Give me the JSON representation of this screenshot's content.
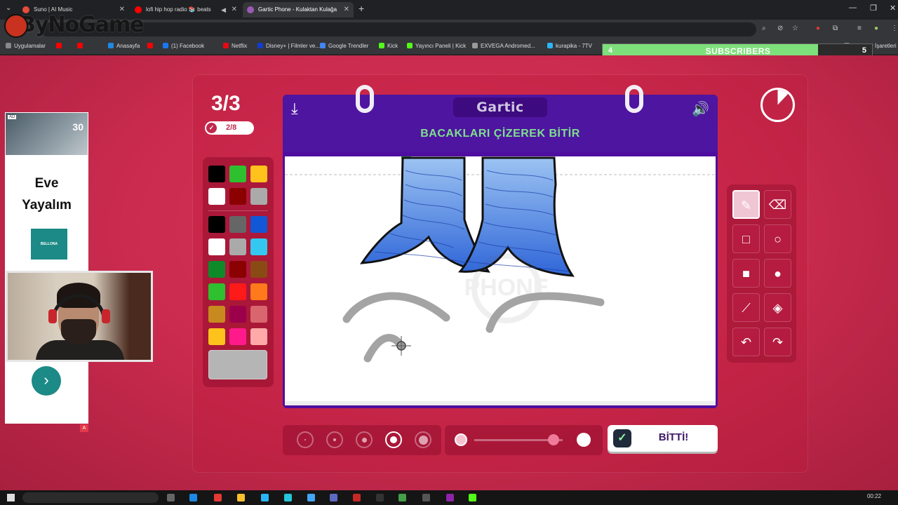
{
  "tabs": [
    {
      "title": "Suno | AI Music",
      "color": "#e74c3c"
    },
    {
      "title": "lofi hip hop radio 📚 beats",
      "color": "#ff0000"
    },
    {
      "title": "Gartic Phone - Kulaktan Kulağa",
      "color": "#9b59b6"
    }
  ],
  "watermark": "ByNoGame",
  "bookmarks": [
    {
      "label": "Uygulamalar",
      "color": "#888"
    },
    {
      "label": "",
      "color": "#ff0000"
    },
    {
      "label": "",
      "color": "#ff0000"
    },
    {
      "label": "Anasayfa",
      "color": "#1e88e5"
    },
    {
      "label": "",
      "color": "#ff0000"
    },
    {
      "label": "(1) Facebook",
      "color": "#1877f2"
    },
    {
      "label": "Netflix",
      "color": "#e50914"
    },
    {
      "label": "Disney+ | Filmler ve...",
      "color": "#113ccf"
    },
    {
      "label": "Google Trendler",
      "color": "#4285f4"
    },
    {
      "label": "Kick",
      "color": "#53fc18"
    },
    {
      "label": "Yayıncı Paneli | Kick",
      "color": "#53fc18"
    },
    {
      "label": "EXVEGA Andromed...",
      "color": "#999"
    },
    {
      "label": "kurapika - 7TV",
      "color": "#29b6f6"
    },
    {
      "label": "Tüm Yer İşaretleri",
      "color": "#888"
    }
  ],
  "subscribers": {
    "label": "SUBSCRIBERS",
    "current": "4",
    "goal": "5",
    "progress": 0.8
  },
  "ad": {
    "badge": "AD",
    "promo": "30",
    "headline_line1": "Eve",
    "headline_line2": "Yayalım",
    "brand": "BELLONA",
    "next_icon": "chevron-right-icon",
    "flag": "A"
  },
  "game": {
    "round": "3/3",
    "votes": "2/8",
    "logo": "Gartic",
    "prompt": "BACAKLARI ÇİZEREK BİTİR",
    "done_label": "BİTTİ!",
    "timer_progress": 0.12,
    "selected_tool": "pencil",
    "selected_size": 4,
    "opacity_level": 0.9
  },
  "palette": {
    "top": [
      "#000000",
      "#2ec02e",
      "#ffc21c",
      "#ffffff",
      "#8b0000",
      "#aaaaaa"
    ],
    "grid": [
      "#000000",
      "#666666",
      "#1258d6",
      "#ffffff",
      "#aaaaaa",
      "#34c8f0",
      "#0e8a2a",
      "#8b0000",
      "#8a4a14",
      "#2ec02e",
      "#ff1a1a",
      "#ff7a1a",
      "#c88a1e",
      "#9c004a",
      "#d9666e",
      "#ffc21c",
      "#ff1a8c",
      "#ffaaa8"
    ],
    "current": "#b5b5b5"
  },
  "tools": [
    {
      "name": "pencil-tool",
      "icon": "pencil-icon",
      "glyph": "✎"
    },
    {
      "name": "eraser-tool",
      "icon": "eraser-icon",
      "glyph": "⌫"
    },
    {
      "name": "rect-outline-tool",
      "icon": "square-outline-icon",
      "glyph": "□"
    },
    {
      "name": "ellipse-outline-tool",
      "icon": "circle-outline-icon",
      "glyph": "○"
    },
    {
      "name": "rect-fill-tool",
      "icon": "square-filled-icon",
      "glyph": "■"
    },
    {
      "name": "ellipse-fill-tool",
      "icon": "circle-filled-icon",
      "glyph": "●"
    },
    {
      "name": "line-tool",
      "icon": "line-icon",
      "glyph": "⟋"
    },
    {
      "name": "fill-tool",
      "icon": "bucket-icon",
      "glyph": "◈"
    },
    {
      "name": "undo-tool",
      "icon": "undo-icon",
      "glyph": "↶"
    },
    {
      "name": "redo-tool",
      "icon": "redo-icon",
      "glyph": "↷"
    }
  ],
  "taskbar": {
    "time": "00:22"
  },
  "colors": {
    "accent": "#4e15a0",
    "prompt": "#7de08c",
    "page": "#d32f55"
  }
}
